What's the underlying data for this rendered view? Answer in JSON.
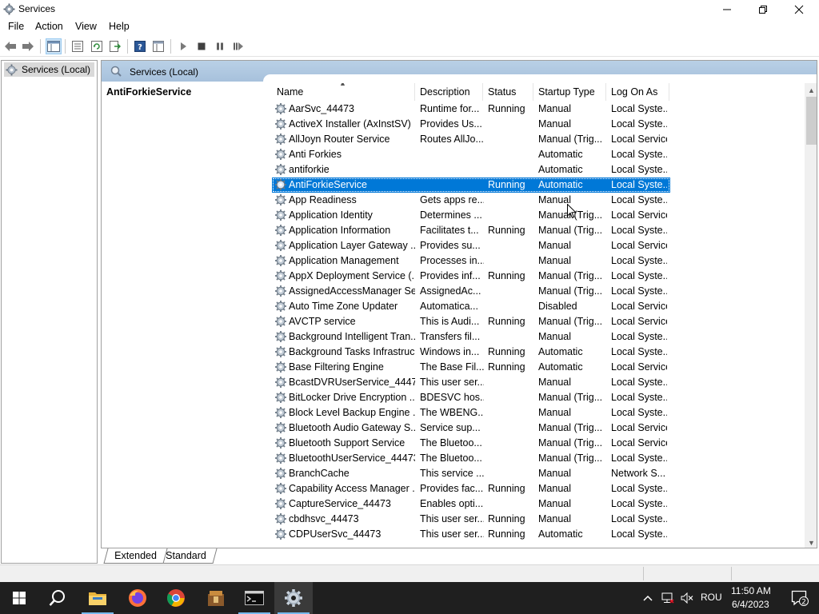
{
  "window": {
    "title": "Services",
    "icon": "gear-icon"
  },
  "menu": [
    "File",
    "Action",
    "View",
    "Help"
  ],
  "toolbar_icons": [
    "back-icon",
    "forward-icon",
    "console-tree-icon",
    "properties-icon",
    "refresh-icon",
    "export-list-icon",
    "help-icon",
    "details-view-icon",
    "start-service-icon",
    "stop-service-icon",
    "pause-service-icon",
    "restart-service-icon"
  ],
  "tree": {
    "item": "Services (Local)"
  },
  "pane": {
    "header": "Services (Local)",
    "selected_name": "AntiForkieService"
  },
  "columns": {
    "name": "Name",
    "description": "Description",
    "status": "Status",
    "startup_type": "Startup Type",
    "log_on_as": "Log On As"
  },
  "services": [
    {
      "name": "AarSvc_44473",
      "description": "Runtime for...",
      "status": "Running",
      "startup": "Manual",
      "logon": "Local Syste..."
    },
    {
      "name": "ActiveX Installer (AxInstSV)",
      "description": "Provides Us...",
      "status": "",
      "startup": "Manual",
      "logon": "Local Syste..."
    },
    {
      "name": "AllJoyn Router Service",
      "description": "Routes AllJo...",
      "status": "",
      "startup": "Manual (Trig...",
      "logon": "Local Service"
    },
    {
      "name": "Anti Forkies",
      "description": "",
      "status": "",
      "startup": "Automatic",
      "logon": "Local Syste..."
    },
    {
      "name": "antiforkie",
      "description": "",
      "status": "",
      "startup": "Automatic",
      "logon": "Local Syste..."
    },
    {
      "name": "AntiForkieService",
      "description": "",
      "status": "Running",
      "startup": "Automatic",
      "logon": "Local Syste...",
      "selected": true
    },
    {
      "name": "App Readiness",
      "description": "Gets apps re...",
      "status": "",
      "startup": "Manual",
      "logon": "Local Syste..."
    },
    {
      "name": "Application Identity",
      "description": "Determines ...",
      "status": "",
      "startup": "Manual (Trig...",
      "logon": "Local Service"
    },
    {
      "name": "Application Information",
      "description": "Facilitates t...",
      "status": "Running",
      "startup": "Manual (Trig...",
      "logon": "Local Syste..."
    },
    {
      "name": "Application Layer Gateway ...",
      "description": "Provides su...",
      "status": "",
      "startup": "Manual",
      "logon": "Local Service"
    },
    {
      "name": "Application Management",
      "description": "Processes in...",
      "status": "",
      "startup": "Manual",
      "logon": "Local Syste..."
    },
    {
      "name": "AppX Deployment Service (...",
      "description": "Provides inf...",
      "status": "Running",
      "startup": "Manual (Trig...",
      "logon": "Local Syste..."
    },
    {
      "name": "AssignedAccessManager Se...",
      "description": "AssignedAc...",
      "status": "",
      "startup": "Manual (Trig...",
      "logon": "Local Syste..."
    },
    {
      "name": "Auto Time Zone Updater",
      "description": "Automatica...",
      "status": "",
      "startup": "Disabled",
      "logon": "Local Service"
    },
    {
      "name": "AVCTP service",
      "description": "This is Audi...",
      "status": "Running",
      "startup": "Manual (Trig...",
      "logon": "Local Service"
    },
    {
      "name": "Background Intelligent Tran...",
      "description": "Transfers fil...",
      "status": "",
      "startup": "Manual",
      "logon": "Local Syste..."
    },
    {
      "name": "Background Tasks Infrastruc...",
      "description": "Windows in...",
      "status": "Running",
      "startup": "Automatic",
      "logon": "Local Syste..."
    },
    {
      "name": "Base Filtering Engine",
      "description": "The Base Fil...",
      "status": "Running",
      "startup": "Automatic",
      "logon": "Local Service"
    },
    {
      "name": "BcastDVRUserService_44473",
      "description": "This user ser...",
      "status": "",
      "startup": "Manual",
      "logon": "Local Syste..."
    },
    {
      "name": "BitLocker Drive Encryption ...",
      "description": "BDESVC hos...",
      "status": "",
      "startup": "Manual (Trig...",
      "logon": "Local Syste..."
    },
    {
      "name": "Block Level Backup Engine ...",
      "description": "The WBENG...",
      "status": "",
      "startup": "Manual",
      "logon": "Local Syste..."
    },
    {
      "name": "Bluetooth Audio Gateway S...",
      "description": "Service sup...",
      "status": "",
      "startup": "Manual (Trig...",
      "logon": "Local Service"
    },
    {
      "name": "Bluetooth Support Service",
      "description": "The Bluetoo...",
      "status": "",
      "startup": "Manual (Trig...",
      "logon": "Local Service"
    },
    {
      "name": "BluetoothUserService_44473",
      "description": "The Bluetoo...",
      "status": "",
      "startup": "Manual (Trig...",
      "logon": "Local Syste..."
    },
    {
      "name": "BranchCache",
      "description": "This service ...",
      "status": "",
      "startup": "Manual",
      "logon": "Network S..."
    },
    {
      "name": "Capability Access Manager ...",
      "description": "Provides fac...",
      "status": "Running",
      "startup": "Manual",
      "logon": "Local Syste..."
    },
    {
      "name": "CaptureService_44473",
      "description": "Enables opti...",
      "status": "",
      "startup": "Manual",
      "logon": "Local Syste..."
    },
    {
      "name": "cbdhsvc_44473",
      "description": "This user ser...",
      "status": "Running",
      "startup": "Manual",
      "logon": "Local Syste..."
    },
    {
      "name": "CDPUserSvc_44473",
      "description": "This user ser...",
      "status": "Running",
      "startup": "Automatic",
      "logon": "Local Syste..."
    }
  ],
  "tabs": [
    "Extended",
    "Standard"
  ],
  "taskbar": {
    "icons": [
      "windows-start-icon",
      "search-icon",
      "file-explorer-icon",
      "firefox-icon",
      "chrome-icon",
      "archive-app-icon",
      "terminal-icon",
      "services-gear-icon"
    ],
    "language": "ROU",
    "time": "11:50 AM",
    "date": "6/4/2023",
    "notification_count": "2"
  }
}
